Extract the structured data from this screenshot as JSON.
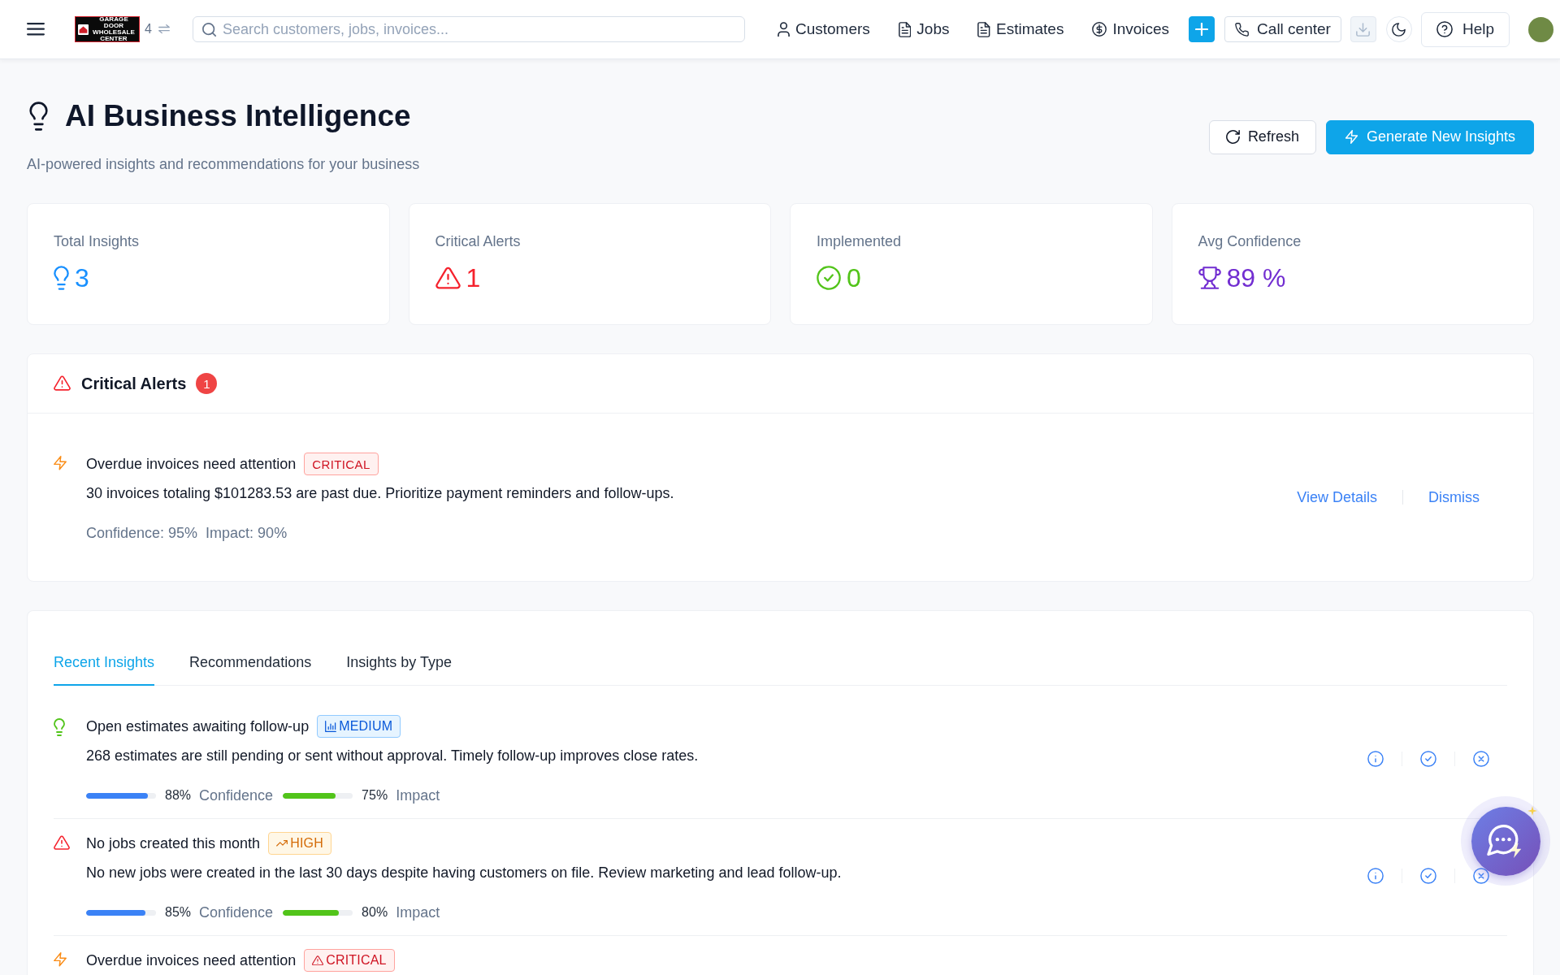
{
  "topbar": {
    "logo_text": "GARAGE DOOR WHOLESALE CENTER",
    "counter": "4",
    "search": {
      "placeholder": "Search customers, jobs, invoices..."
    },
    "nav": [
      {
        "label": "Customers",
        "kind": "person"
      },
      {
        "label": "Jobs",
        "kind": "document"
      },
      {
        "label": "Estimates",
        "kind": "document"
      },
      {
        "label": "Invoices",
        "kind": "money"
      }
    ],
    "call_center": "Call center",
    "download": {
      "disabled": true
    },
    "help": "Help"
  },
  "header": {
    "title": "AI Business Intelligence",
    "subtitle": "AI-powered insights and recommendations for your business",
    "buttons": [
      {
        "label": "Refresh",
        "kind": "refresh"
      },
      {
        "label": "Generate New Insights",
        "kind": "generate"
      }
    ]
  },
  "stats": [
    {
      "label": "Total Insights",
      "value": "3",
      "kind": "bulb",
      "color": "#1890ff"
    },
    {
      "label": "Critical Alerts",
      "value": "1",
      "kind": "warning",
      "color": "#f5222d"
    },
    {
      "label": "Implemented",
      "value": "0",
      "kind": "check",
      "color": "#52c41a"
    },
    {
      "label": "Avg Confidence",
      "value": "89 %",
      "kind": "trophy",
      "color": "#722ed1"
    }
  ],
  "critical_alerts": {
    "title": "Critical Alerts",
    "count": "1",
    "alerts": [
      {
        "kind": "bolt",
        "title": "Overdue invoices need attention",
        "tag": {
          "text": "CRITICAL",
          "kind": "critical"
        },
        "description": "30 invoices totaling $101283.53 are past due. Prioritize payment reminders and follow-ups.",
        "confidence": "Confidence: 95%",
        "impact": "Impact: 90%",
        "actions": [
          "View Details",
          "Dismiss"
        ]
      }
    ]
  },
  "insights": {
    "tabs": [
      {
        "label": "Recent Insights",
        "selected": true
      },
      {
        "label": "Recommendations",
        "selected": false
      },
      {
        "label": "Insights by Type",
        "selected": false
      }
    ],
    "items": [
      {
        "kind": "bulb",
        "title": "Open estimates awaiting follow-up",
        "tag": {
          "text": "MEDIUM",
          "kind": "medium"
        },
        "description": "268 estimates are still pending or sent without approval. Timely follow-up improves close rates.",
        "confidence": {
          "level": 0.88,
          "reading": "88%",
          "label": "Confidence"
        },
        "impact": {
          "level": 0.75,
          "reading": "75%",
          "label": "Impact"
        },
        "actions": true
      },
      {
        "kind": "warning",
        "title": "No jobs created this month",
        "tag": {
          "text": "HIGH",
          "kind": "high"
        },
        "description": "No new jobs were created in the last 30 days despite having customers on file. Review marketing and lead follow-up.",
        "confidence": {
          "level": 0.85,
          "reading": "85%",
          "label": "Confidence"
        },
        "impact": {
          "level": 0.8,
          "reading": "80%",
          "label": "Impact"
        },
        "actions": true
      },
      {
        "kind": "bolt",
        "title": "Overdue invoices need attention",
        "tag": {
          "text": "CRITICAL",
          "kind": "critical"
        },
        "actions": false
      }
    ]
  }
}
